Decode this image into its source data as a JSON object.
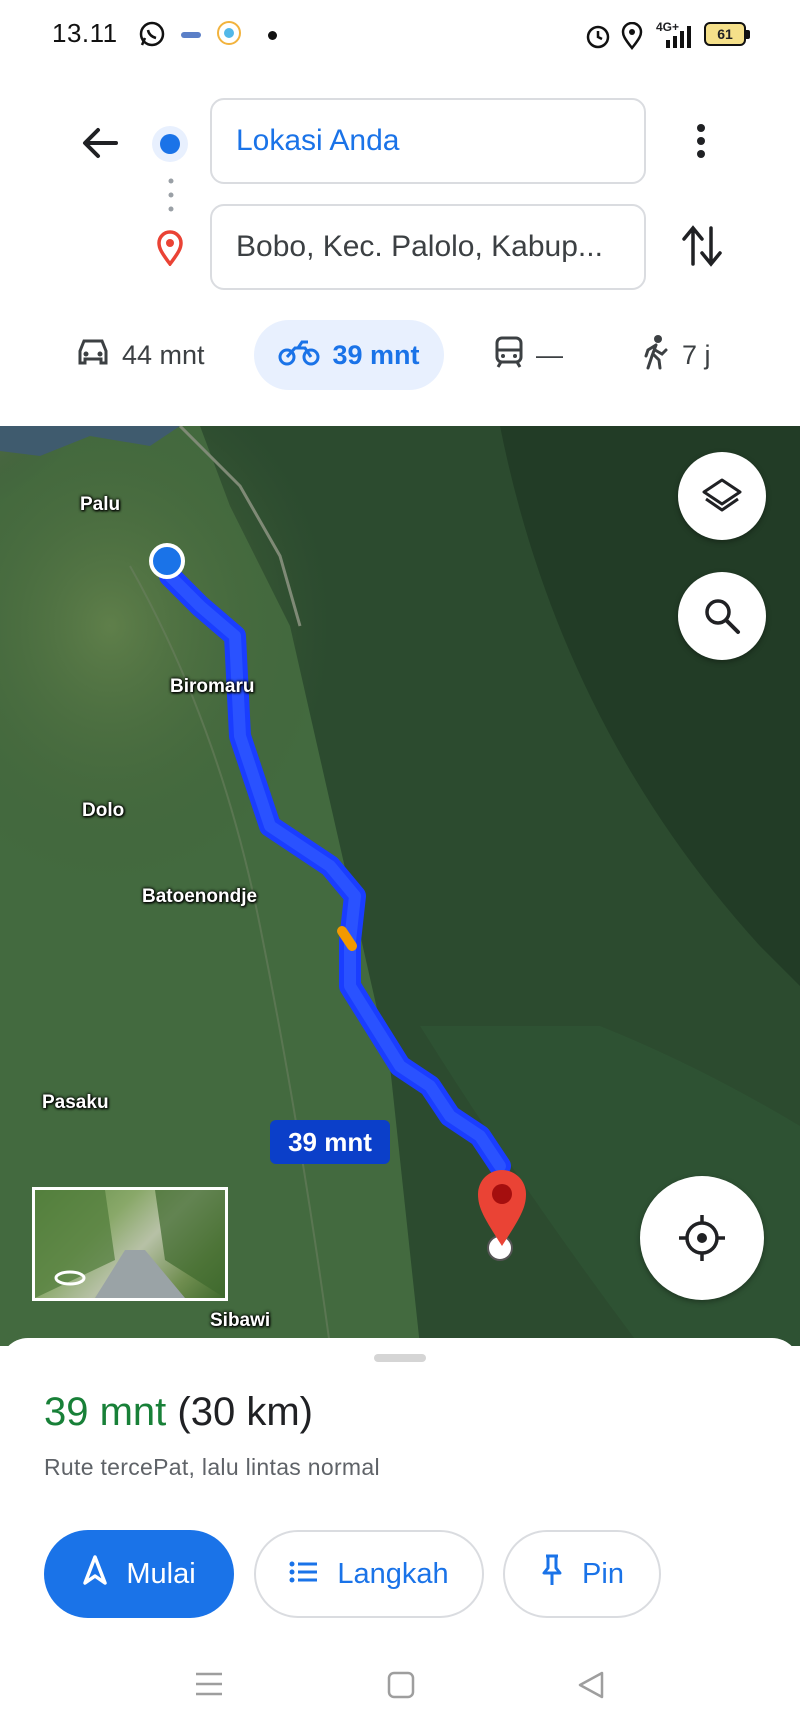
{
  "status_bar": {
    "time": "13.11",
    "network": "4G+",
    "battery": "61",
    "icons": [
      "whatsapp-icon",
      "app-icon",
      "realme-icon",
      "dot-icon",
      "alarm-icon",
      "location-icon",
      "signal-icon",
      "battery-icon"
    ]
  },
  "directions": {
    "origin": "Lokasi Anda",
    "destination": "Bobo, Kec. Palolo, Kabup..."
  },
  "modes": [
    {
      "name": "car",
      "label": "44 mnt"
    },
    {
      "name": "motorcycle",
      "label": "39 mnt",
      "selected": true
    },
    {
      "name": "transit",
      "label": "—"
    },
    {
      "name": "walk",
      "label": "7 j"
    }
  ],
  "map": {
    "labels": [
      "Palu",
      "Biromaru",
      "Dolo",
      "Batoenondje",
      "Pasaku",
      "Sibawi"
    ],
    "route_badge": "39 mnt",
    "route_color": "#1a3dff"
  },
  "summary": {
    "duration": "39 mnt",
    "distance": "(30 km)",
    "description": "Rute tercePat, lalu lintas normal"
  },
  "actions": {
    "start": "Mulai",
    "steps": "Langkah",
    "pin": "Pin"
  },
  "colors": {
    "accent": "#1a73e8",
    "green": "#188038",
    "pin_red": "#ea4335"
  }
}
